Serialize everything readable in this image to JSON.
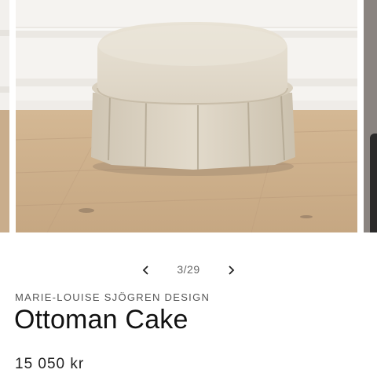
{
  "gallery": {
    "image_alt": "Round pleated ottoman in beige linen on wooden floor",
    "current": 3,
    "total": 29,
    "counter_text": "3/29",
    "prev_icon": "chevron-left-icon",
    "next_icon": "chevron-right-icon"
  },
  "product": {
    "brand": "MARIE-LOUISE SJÖGREN DESIGN",
    "name": "Ottoman Cake",
    "price": "15 050 kr"
  },
  "colors": {
    "text_primary": "#111111",
    "text_secondary": "#555555",
    "background": "#ffffff"
  }
}
